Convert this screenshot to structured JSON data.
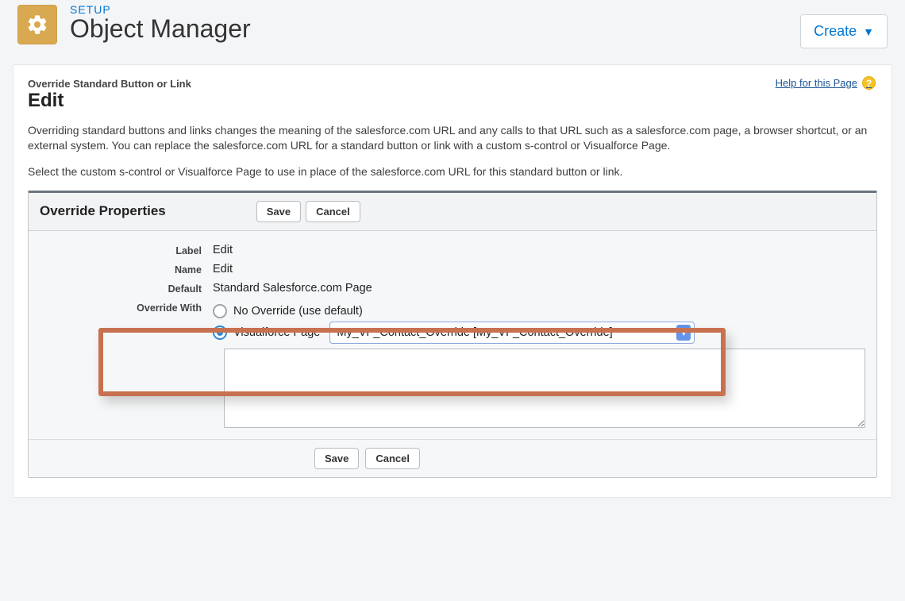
{
  "header": {
    "setup": "SETUP",
    "title": "Object Manager",
    "create": "Create"
  },
  "helpLink": "Help for this Page",
  "supertitle": "Override Standard Button or Link",
  "pageTitle": "Edit",
  "paragraph1": "Overriding standard buttons and links changes the meaning of the salesforce.com URL and any calls to that URL such as a salesforce.com page, a browser shortcut, or an external system. You can replace the salesforce.com URL for a standard button or link with a custom s-control or Visualforce Page.",
  "paragraph2": "Select the custom s-control or Visualforce Page to use in place of the salesforce.com URL for this standard button or link.",
  "panelTitle": "Override Properties",
  "buttons": {
    "save": "Save",
    "cancel": "Cancel"
  },
  "fields": {
    "labelLabel": "Label",
    "labelValue": "Edit",
    "nameLabel": "Name",
    "nameValue": "Edit",
    "defaultLabel": "Default",
    "defaultValue": "Standard Salesforce.com Page",
    "overrideWithLabel": "Override With"
  },
  "overrideOptions": {
    "noOverride": "No Override (use default)",
    "visualforce": "Visualforce Page",
    "selectedPage": "My_VF_Contact_Override [My_VF_Contact_Override]"
  }
}
